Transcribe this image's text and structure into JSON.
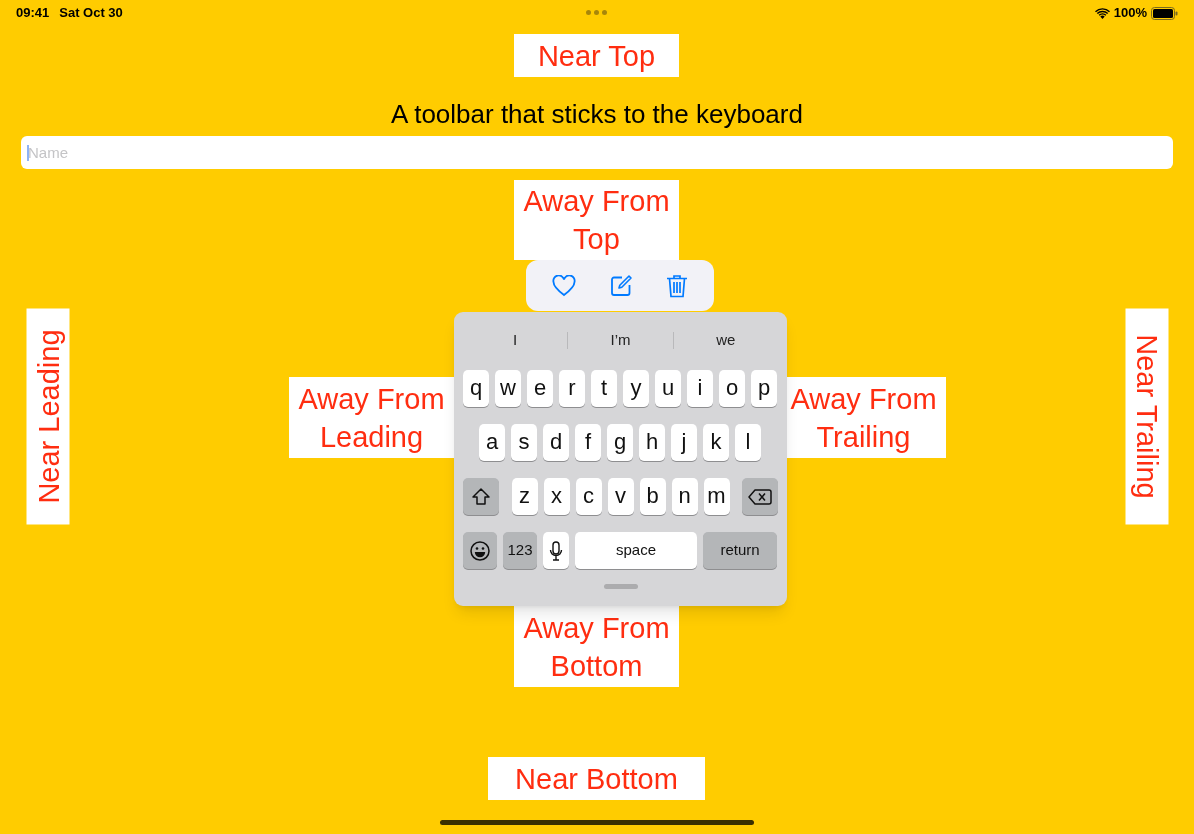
{
  "status_bar": {
    "time": "09:41",
    "date": "Sat Oct 30",
    "battery": "100%"
  },
  "title": "A toolbar that sticks to the keyboard",
  "name_field": {
    "placeholder": "Name"
  },
  "labels": [
    {
      "kind": "near_top",
      "text": "Near Top"
    },
    {
      "kind": "away_top",
      "text": "Away From Top"
    },
    {
      "kind": "near_leading",
      "text": "Near Leading"
    },
    {
      "kind": "away_leading",
      "text": "Away From Leading"
    },
    {
      "kind": "away_trailing",
      "text": "Away From Trailing"
    },
    {
      "kind": "near_trailing",
      "text": "Near Trailing"
    },
    {
      "kind": "away_bottom",
      "text": "Away From Bottom"
    },
    {
      "kind": "near_bottom",
      "text": "Near Bottom"
    }
  ],
  "keyboard": {
    "suggestions": [
      "I",
      "I’m",
      "we"
    ],
    "rows": [
      [
        {
          "kind": "letter",
          "label": "q"
        },
        {
          "kind": "letter",
          "label": "w"
        },
        {
          "kind": "letter",
          "label": "e"
        },
        {
          "kind": "letter",
          "label": "r"
        },
        {
          "kind": "letter",
          "label": "t"
        },
        {
          "kind": "letter",
          "label": "y"
        },
        {
          "kind": "letter",
          "label": "u"
        },
        {
          "kind": "letter",
          "label": "i"
        },
        {
          "kind": "letter",
          "label": "o"
        },
        {
          "kind": "letter",
          "label": "p"
        }
      ],
      [
        {
          "kind": "letter",
          "label": "a"
        },
        {
          "kind": "letter",
          "label": "s"
        },
        {
          "kind": "letter",
          "label": "d"
        },
        {
          "kind": "letter",
          "label": "f"
        },
        {
          "kind": "letter",
          "label": "g"
        },
        {
          "kind": "letter",
          "label": "h"
        },
        {
          "kind": "letter",
          "label": "j"
        },
        {
          "kind": "letter",
          "label": "k"
        },
        {
          "kind": "letter",
          "label": "l"
        }
      ],
      [
        {
          "kind": "shift"
        },
        {
          "kind": "letter",
          "label": "z"
        },
        {
          "kind": "letter",
          "label": "x"
        },
        {
          "kind": "letter",
          "label": "c"
        },
        {
          "kind": "letter",
          "label": "v"
        },
        {
          "kind": "letter",
          "label": "b"
        },
        {
          "kind": "letter",
          "label": "n"
        },
        {
          "kind": "letter",
          "label": "m"
        },
        {
          "kind": "delete"
        }
      ]
    ],
    "bottom_row": [
      {
        "kind": "emoji"
      },
      {
        "kind": "numbers",
        "label": "123"
      },
      {
        "kind": "mic"
      },
      {
        "kind": "space",
        "label": "space"
      },
      {
        "kind": "return",
        "label": "return"
      }
    ]
  }
}
